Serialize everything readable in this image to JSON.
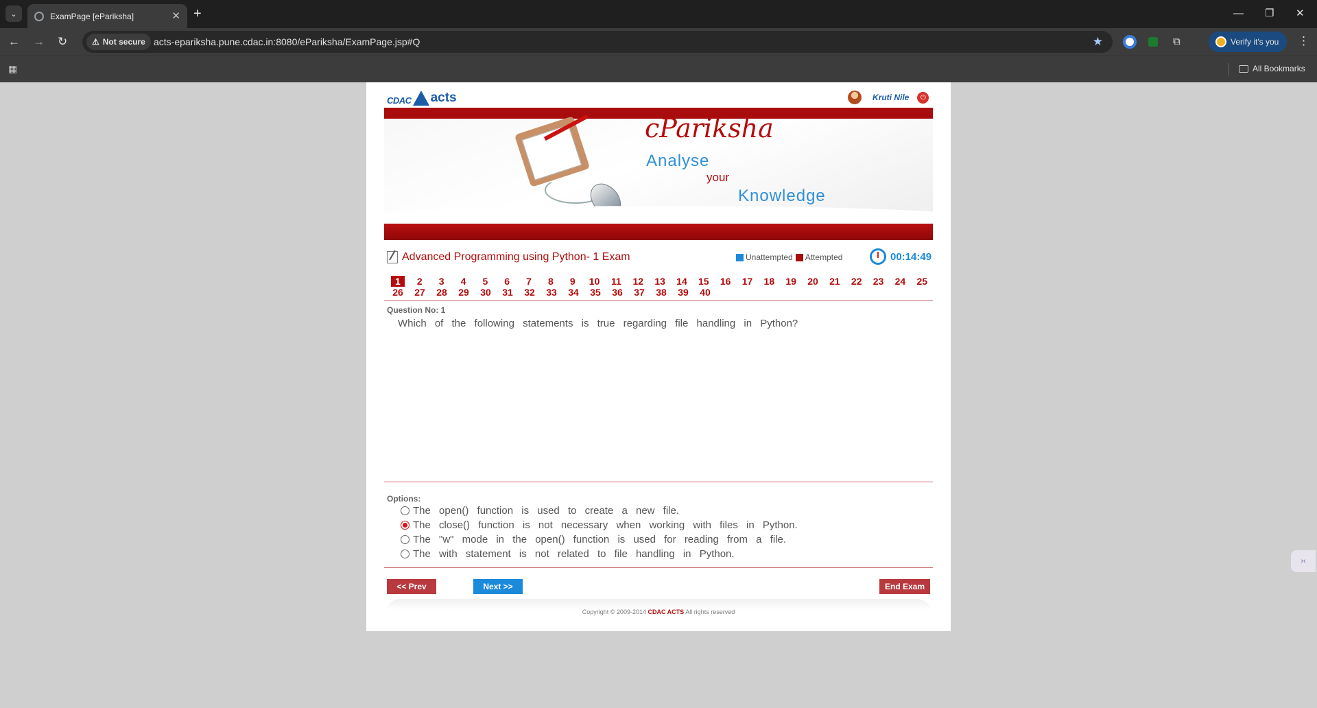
{
  "browser": {
    "tab_title": "ExamPage [ePariksha]",
    "security_label": "Not secure",
    "url": "acts-epariksha.pune.cdac.in:8080/ePariksha/ExamPage.jsp#Q",
    "verify_label": "Verify it's you",
    "all_bookmarks": "All Bookmarks"
  },
  "header": {
    "logo_cdac": "CDAC",
    "logo_acts": "acts",
    "user_name": "Kruti Nile"
  },
  "banner": {
    "brand": "cPariksha",
    "tagline_1": "Analyse",
    "tagline_2": "your",
    "tagline_3": "Knowledge"
  },
  "exam": {
    "title": "Advanced Programming using Python- 1 Exam",
    "legend_unattempted": "Unattempted",
    "legend_attempted": "Attempted",
    "timer": "00:14:49",
    "current_question": 1,
    "questions_row_1": [
      "1",
      "2",
      "3",
      "4",
      "5",
      "6",
      "7",
      "8",
      "9",
      "10",
      "11",
      "12",
      "13",
      "14",
      "15",
      "16",
      "17",
      "18",
      "19",
      "20",
      "21",
      "22",
      "23",
      "24",
      "25"
    ],
    "questions_row_2": [
      "26",
      "27",
      "28",
      "29",
      "30",
      "31",
      "32",
      "33",
      "34",
      "35",
      "36",
      "37",
      "38",
      "39",
      "40"
    ]
  },
  "question": {
    "label": "Question No: 1",
    "text": "Which of the following statements is true regarding file handling in Python?"
  },
  "options": {
    "label": "Options:",
    "items": [
      {
        "text": "The open() function is used to create a new file.",
        "selected": false
      },
      {
        "text": "The close() function is not necessary when working with files in Python.",
        "selected": true
      },
      {
        "text": "The \"w\" mode in the open() function is used for reading from a file.",
        "selected": false
      },
      {
        "text": "The with statement is not related to file handling in Python.",
        "selected": false
      }
    ]
  },
  "buttons": {
    "prev": "<< Prev",
    "next": "Next >>",
    "end": "End Exam"
  },
  "footer": {
    "copyright_prefix": "Copyright © 2009-2014",
    "copyright_brand": "CDAC ACTS",
    "copyright_suffix": "All rights reserved"
  },
  "colors": {
    "brand_red": "#b40c0c",
    "accent_blue": "#1c8adb",
    "button_red": "#b93a3e"
  }
}
